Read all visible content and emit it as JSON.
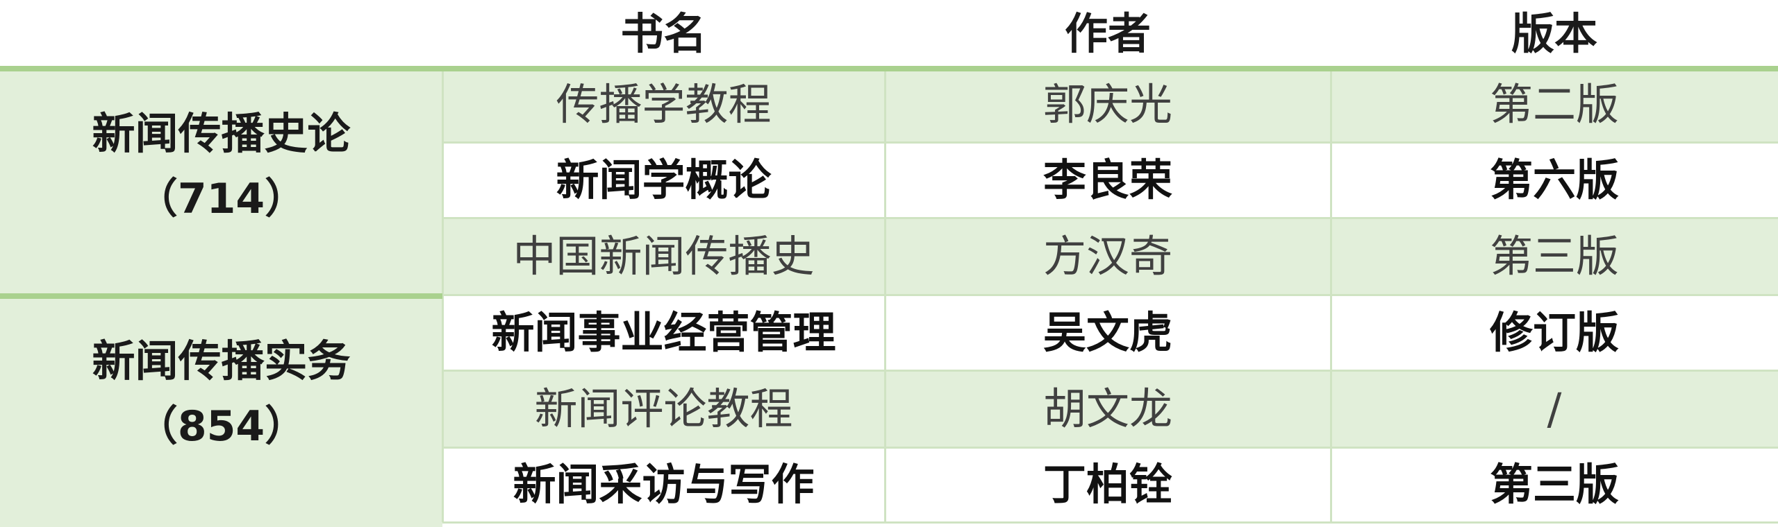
{
  "header": {
    "col_title": "书名",
    "col_author": "作者",
    "col_edition": "版本"
  },
  "groups": [
    {
      "title": "新闻传播史论",
      "code": "（714）"
    },
    {
      "title": "新闻传播实务",
      "code": "（854）"
    }
  ],
  "rows": [
    {
      "title": "传播学教程",
      "author": "郭庆光",
      "edition": "第二版"
    },
    {
      "title": "新闻学概论",
      "author": "李良荣",
      "edition": "第六版"
    },
    {
      "title": "中国新闻传播史",
      "author": "方汉奇",
      "edition": "第三版"
    },
    {
      "title": "新闻事业经营管理",
      "author": "吴文虎",
      "edition": "修订版"
    },
    {
      "title": "新闻评论教程",
      "author": "胡文龙",
      "edition": "/"
    },
    {
      "title": "新闻采访与写作",
      "author": "丁柏铨",
      "edition": "第三版"
    }
  ],
  "colors": {
    "shade": "#e2efda",
    "accent_line": "#a9d18e",
    "grid_line": "#cfe3c2"
  }
}
